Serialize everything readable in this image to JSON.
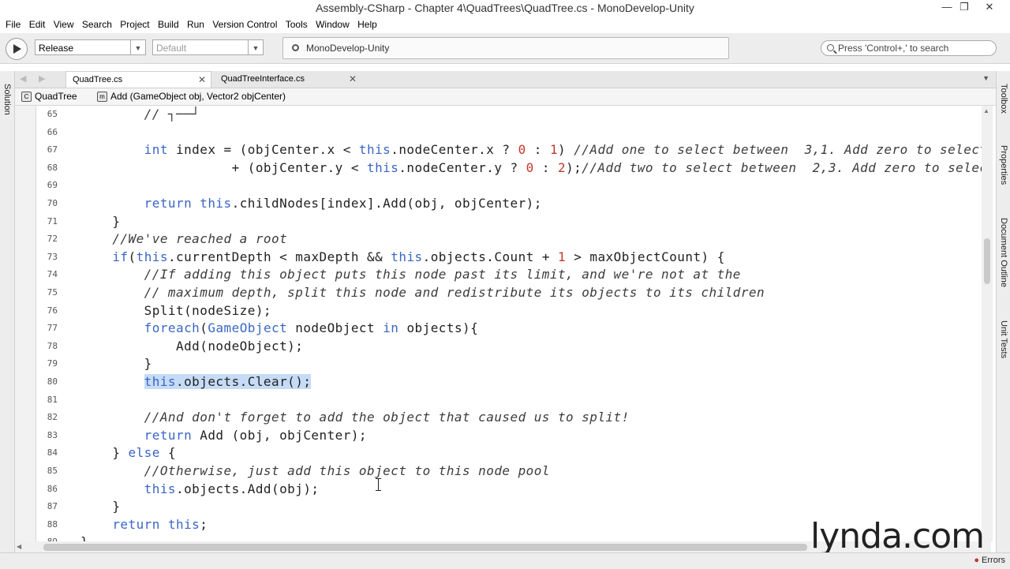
{
  "window": {
    "title": "Assembly-CSharp - Chapter 4\\QuadTrees\\QuadTree.cs - MonoDevelop-Unity",
    "minimize": "—",
    "restore": "❐",
    "close": "✕"
  },
  "menu": [
    "File",
    "Edit",
    "View",
    "Search",
    "Project",
    "Build",
    "Run",
    "Version Control",
    "Tools",
    "Window",
    "Help"
  ],
  "toolbar": {
    "config": "Release",
    "target": "Default",
    "status": "MonoDevelop-Unity",
    "search_placeholder": "Press 'Control+,' to search"
  },
  "left_pad": {
    "solution": "Solution"
  },
  "right_pad": {
    "toolbox": "Toolbox",
    "properties": "Properties",
    "outline": "Document Outline",
    "unit_tests": "Unit Tests"
  },
  "tabs": [
    {
      "label": "QuadTree.cs"
    },
    {
      "label": "QuadTreeInterface.cs"
    }
  ],
  "breadcrumb": {
    "class_name": "QuadTree",
    "method": "Add (GameObject obj, Vector2 objCenter)"
  },
  "editor": {
    "lines": [
      {
        "n": "65",
        "html": "        <span class=\"cm\">// ┐──┘</span>"
      },
      {
        "n": "66",
        "html": ""
      },
      {
        "n": "67",
        "html": "        <span class=\"kw\">int</span> index = (objCenter.x &lt; <span class=\"kw\">this</span>.nodeCenter.x ? <span class=\"num\">0</span> : <span class=\"num\">1</span>) <span class=\"cm\">//Add one to select between  3,1. Add zero to select</span>"
      },
      {
        "n": "68",
        "html": "                   + (objCenter.y &lt; <span class=\"kw\">this</span>.nodeCenter.y ? <span class=\"num\">0</span> : <span class=\"num\">2</span>);<span class=\"cm\">//Add two to select between  2,3. Add zero to select</span>"
      },
      {
        "n": "69",
        "html": ""
      },
      {
        "n": "70",
        "html": "        <span class=\"kw\">return</span> <span class=\"kw\">this</span>.childNodes[index].Add(obj, objCenter);"
      },
      {
        "n": "71",
        "html": "    }"
      },
      {
        "n": "72",
        "html": "    <span class=\"cm\">//We've reached a root</span>"
      },
      {
        "n": "73",
        "html": "    <span class=\"kw\">if</span>(<span class=\"kw\">this</span>.currentDepth &lt; maxDepth &amp;&amp; <span class=\"kw\">this</span>.objects.Count + <span class=\"num\">1</span> &gt; maxObjectCount) {"
      },
      {
        "n": "74",
        "html": "        <span class=\"cm\">//If adding this object puts this node past its limit, and we're not at the</span>"
      },
      {
        "n": "75",
        "html": "        <span class=\"cm\">// maximum depth, split this node and redistribute its objects to its children</span>"
      },
      {
        "n": "76",
        "html": "        Split(nodeSize);"
      },
      {
        "n": "77",
        "html": "        <span class=\"kw\">foreach</span>(<span class=\"kw\">GameObject</span> nodeObject <span class=\"kw\">in</span> objects){"
      },
      {
        "n": "78",
        "html": "            Add(nodeObject);"
      },
      {
        "n": "79",
        "html": "        }"
      },
      {
        "n": "80",
        "html": "        <span class=\"sel\"><span class=\"kw\">this</span>.objects.Clear();</span>"
      },
      {
        "n": "81",
        "html": ""
      },
      {
        "n": "82",
        "html": "        <span class=\"cm\">//And don't forget to add the object that caused us to split!</span>"
      },
      {
        "n": "83",
        "html": "        <span class=\"kw\">return</span> Add (obj, objCenter);"
      },
      {
        "n": "84",
        "html": "    } <span class=\"kw\">else</span> {"
      },
      {
        "n": "85",
        "html": "        <span class=\"cm\">//Otherwise, just add this object to this node pool</span>"
      },
      {
        "n": "86",
        "html": "        <span class=\"kw\">this</span>.objects.Add(obj);"
      },
      {
        "n": "87",
        "html": "    }"
      },
      {
        "n": "88",
        "html": "    <span class=\"kw\">return</span> <span class=\"kw\">this</span>;"
      },
      {
        "n": "89",
        "html": "}"
      }
    ]
  },
  "status": {
    "errors": "Errors"
  },
  "watermark": {
    "brand": "lynda.com"
  }
}
